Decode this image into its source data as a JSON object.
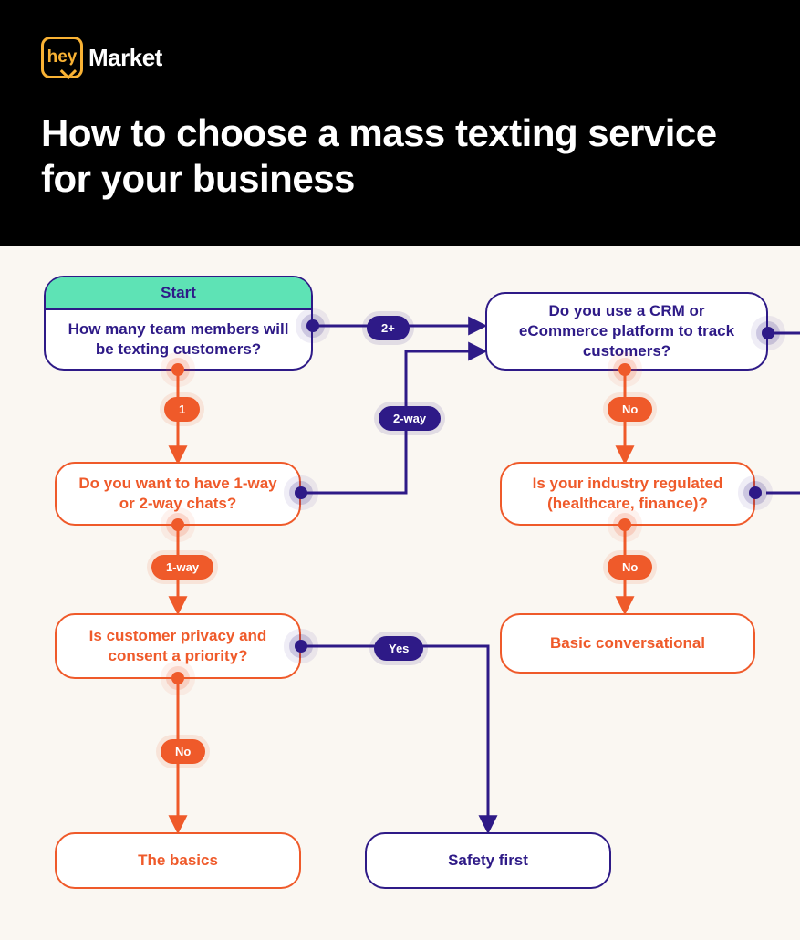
{
  "brand": {
    "icon_text": "hey",
    "name": "Market"
  },
  "title": "How to choose a mass texting service for your business",
  "colors": {
    "purple": "#2e1a87",
    "orange": "#ef5a2a",
    "mint": "#5ee3b5",
    "gold": "#f9b234",
    "bg": "#faf7f2"
  },
  "flow": {
    "start_label": "Start",
    "nodes": {
      "q_team": "How many team members will be texting customers?",
      "q_crm": "Do you use a CRM or eCommerce platform to track customers?",
      "q_chat": "Do you want to have 1-way or 2-way chats?",
      "q_industry": "Is your industry regulated (healthcare, finance)?",
      "q_privacy": "Is customer privacy and consent a priority?",
      "r_basic_conv": "Basic conversational",
      "r_basics": "The basics",
      "r_safety": "Safety first"
    },
    "edges": {
      "team_2plus": "2+",
      "team_1": "1",
      "chat_2way": "2-way",
      "chat_1way": "1-way",
      "crm_no": "No",
      "industry_no": "No",
      "privacy_no": "No",
      "privacy_yes": "Yes"
    }
  }
}
